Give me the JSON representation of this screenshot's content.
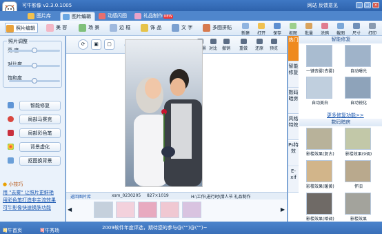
{
  "app": {
    "title": "可牛影像 v2.3.0.1005",
    "links": [
      "网站",
      "反馈意见"
    ],
    "window_controls": [
      "_",
      "□",
      "×"
    ]
  },
  "tabs": [
    {
      "label": "图片库",
      "icon": "folder-icon"
    },
    {
      "label": "图片编辑",
      "icon": "edit-icon",
      "active": true
    },
    {
      "label": "动感闪图",
      "icon": "flash-icon"
    },
    {
      "label": "礼品制作",
      "icon": "gift-icon",
      "badge": "NEW"
    }
  ],
  "toolbar": {
    "items": [
      {
        "label": "照片编辑",
        "icon": "photo-icon",
        "selected": true
      },
      {
        "label": "美 容",
        "icon": "face-icon"
      },
      {
        "label": "场 景",
        "icon": "scene-icon"
      },
      {
        "label": "边 框",
        "icon": "frame-icon"
      },
      {
        "label": "饰 品",
        "icon": "ornament-icon"
      },
      {
        "label": "文 字",
        "icon": "text-icon"
      },
      {
        "label": "多图拼贴",
        "icon": "collage-icon"
      }
    ],
    "right": [
      {
        "label": "新建",
        "icon": "new-icon"
      },
      {
        "label": "打开",
        "icon": "open-icon"
      },
      {
        "label": "保存",
        "icon": "save-icon"
      },
      {
        "label": "抠图",
        "icon": "cutout-icon"
      },
      {
        "label": "批量",
        "icon": "batch-icon"
      },
      {
        "label": "涂鸦",
        "icon": "brush-icon"
      },
      {
        "label": "截图",
        "icon": "screenshot-icon"
      },
      {
        "label": "尺寸",
        "icon": "size-icon"
      },
      {
        "label": "打印",
        "icon": "print-icon"
      }
    ]
  },
  "adjust": {
    "title": "照片调整",
    "sliders": [
      {
        "label": "亮 度",
        "value": 0.5
      },
      {
        "label": "对比度",
        "value": 0.5
      },
      {
        "label": "饱和度",
        "value": 0.5
      }
    ]
  },
  "functions": [
    {
      "label": "智能修复",
      "icon": "magic-icon"
    },
    {
      "label": "局部马赛克",
      "icon": "mosaic-icon"
    },
    {
      "label": "局部彩色笔",
      "icon": "color-pen-icon"
    },
    {
      "label": "背景虚化",
      "icon": "blur-icon"
    },
    {
      "label": "抠图换背景",
      "icon": "cutout-bg-icon"
    }
  ],
  "tips": {
    "title": "小技巧",
    "items": [
      "用 \"去雾\" 让照片更鲜艳",
      "用彩色笔打造非主流效果",
      "可牛影像快速换肤功能"
    ]
  },
  "canvas": {
    "tools": [
      {
        "label": "换背景",
        "icon": "change-bg-icon"
      },
      {
        "label": "对比",
        "icon": "compare-icon"
      },
      {
        "label": "撤销",
        "icon": "undo-icon"
      },
      {
        "label": "重做",
        "icon": "redo-icon"
      },
      {
        "label": "还原",
        "icon": "restore-icon"
      },
      {
        "label": "预览",
        "icon": "preview-icon"
      }
    ]
  },
  "strip": {
    "back": "返回图片库",
    "filename": "xsm_0230205",
    "size": "827×1019",
    "path": "H:\\工作\\进行时\\情人节 礼品制作"
  },
  "right_panel": {
    "vtabs": [
      "热门",
      "智能修复",
      "数码暗房",
      "风格特效",
      "Ps特效",
      "E-xif"
    ],
    "section1": "智能修复",
    "effects1": [
      "一键去雾(去雾)",
      "自动曝光",
      "自动美白",
      "自动锐化"
    ],
    "more": "更多修复功能>>",
    "section2": "数码暗房",
    "effects2": [
      "影楼效果(复古)",
      "影楼效果(9调)",
      "影楼效果(暖黄)",
      "怀旧",
      "影楼效果(暗调)",
      "影楼效果"
    ]
  },
  "status": {
    "left": "可牛首页",
    "left2": "可牛秀场",
    "message": "2009软件年度评选，期待您的参与@(\"\")@(\"\")~"
  }
}
